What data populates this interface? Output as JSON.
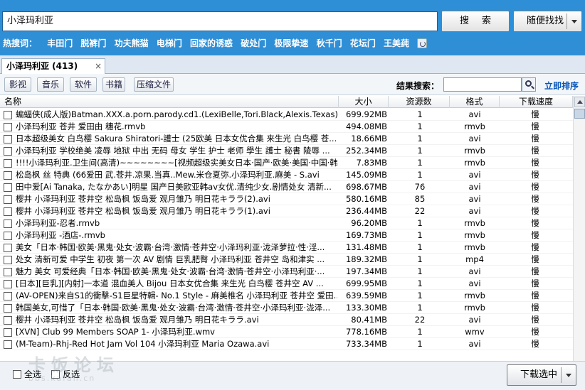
{
  "search": {
    "query": "小泽玛利亚",
    "search_button": "搜索",
    "random_button": "随便找找"
  },
  "hot": {
    "label": "热搜词：",
    "items": [
      "丰田门",
      "脱裤门",
      "功夫熊猫",
      "电梯门",
      "回家的诱惑",
      "破处门",
      "极限挚速",
      "秋千门",
      "花坛门",
      "王美莼"
    ]
  },
  "tab": {
    "label": "小泽玛利亚 (413)",
    "close": "×"
  },
  "filters": {
    "buttons": [
      "影视",
      "音乐",
      "软件",
      "书籍",
      "压缩文件"
    ],
    "result_label": "结果搜索：",
    "sort_link": "立即排序"
  },
  "columns": {
    "name": "名称",
    "size": "大小",
    "resources": "资源数",
    "format": "格式",
    "speed": "下载速度"
  },
  "rows": [
    {
      "name": "蝙蝠侠(成人版)Batman.XXX.a.porn.parody.cd1.(LexiBelle,Tori.Black,Alexis.Texas).Bijou 日...",
      "size": "699.92MB",
      "res": "1",
      "fmt": "avi",
      "speed": "慢"
    },
    {
      "name": "小泽玛利亚 苍井 爱田由 穗花.rmvb",
      "size": "494.08MB",
      "res": "1",
      "fmt": "rmvb",
      "speed": "慢"
    },
    {
      "name": "日本超级美女 白鸟樱 Sakura Shiratori-護士 (25欧美 日本女优合集 来生光 白鸟樱 苍...",
      "size": "18.66MB",
      "res": "1",
      "fmt": "avi",
      "speed": "慢"
    },
    {
      "name": "小泽玛利亚 学校绝美 凌辱 地狱 中出 无码 母女 学生 护士 老师 學生 護士 秘書 陵辱 ...",
      "size": "252.34MB",
      "res": "1",
      "fmt": "rmvb",
      "speed": "慢"
    },
    {
      "name": "!!!!小泽玛利亚.卫生间(高清)~~~~~~~~[视频超级实美女日本·国产·欧美·美国·中国·韩...",
      "size": "7.83MB",
      "res": "1",
      "fmt": "rmvb",
      "speed": "慢"
    },
    {
      "name": "松岛枫 丝 特典 (66爱田 武.苍井.凉果.当真..Mew.米仓夏弥.小泽玛利亚.麻美 - S.avi",
      "size": "145.09MB",
      "res": "1",
      "fmt": "avi",
      "speed": "慢"
    },
    {
      "name": "田中爱[Ai Tanaka, たなかあい]明星 国产日美欧亚韩av女优.清纯少女.剧情处女 清新...",
      "size": "698.67MB",
      "res": "76",
      "fmt": "avi",
      "speed": "慢"
    },
    {
      "name": "樱井 小泽玛利亚 苍井空 松岛枫 饭岛爱 观月雏乃 明日花キララ(2).avi",
      "size": "580.16MB",
      "res": "85",
      "fmt": "avi",
      "speed": "慢"
    },
    {
      "name": "樱井 小泽玛利亚 苍井空 松岛枫 饭岛爱 观月雏乃 明日花キララ(1).avi",
      "size": "236.44MB",
      "res": "22",
      "fmt": "avi",
      "speed": "慢"
    },
    {
      "name": "小泽玛利亚-忍者.rmvb",
      "size": "96.20MB",
      "res": "1",
      "fmt": "rmvb",
      "speed": "慢"
    },
    {
      "name": "小泽玛利亚 -酒店-.rmvb",
      "size": "169.73MB",
      "res": "1",
      "fmt": "rmvb",
      "speed": "慢"
    },
    {
      "name": "美女「日本·韩国·欧美·黑鬼·处女·波霸·台湾·激情·苍井空·小泽玛利亚·泷泽萝拉·性·淫...",
      "size": "131.48MB",
      "res": "1",
      "fmt": "rmvb",
      "speed": "慢"
    },
    {
      "name": "处女 清新可爱 中学生 初夜 第一次 AV 剧情 巨乳肥臀 小泽玛利亚 苍井空 岛和津实 ...",
      "size": "189.32MB",
      "res": "1",
      "fmt": "mp4",
      "speed": "慢"
    },
    {
      "name": "魅力 美女 可爱经典「日本·韩国·欧美·黑鬼·处女·波霸·台湾·激情·苍井空·小泽玛利亚·...",
      "size": "197.34MB",
      "res": "1",
      "fmt": "avi",
      "speed": "慢"
    },
    {
      "name": "[日本][巨乳][内射]一本道 混血美人 Bijou 日本女优合集 来生光 白鸟樱 苍井空 AV ...",
      "size": "699.95MB",
      "res": "1",
      "fmt": "avi",
      "speed": "慢"
    },
    {
      "name": "(AV-OPEN)来自S1的衝擊-S1巨星特輯- No.1 Style - 麻美椎名 小泽玛利亚 苍井空 爱田...",
      "size": "639.59MB",
      "res": "1",
      "fmt": "rmvb",
      "speed": "慢"
    },
    {
      "name": "韩国美女,可惜了「日本·韩国·欧美·黑鬼·处女·波霸·台湾·激情·苍井空·小泽玛利亚·泷泽...",
      "size": "133.30MB",
      "res": "1",
      "fmt": "rmvb",
      "speed": "慢"
    },
    {
      "name": "樱井 小泽玛利亚 苍井空 松岛枫 饭岛爱 观月雏乃 明日花キララ.avi",
      "size": "80.41MB",
      "res": "22",
      "fmt": "avi",
      "speed": "慢"
    },
    {
      "name": "[XVN] Club 99 Members SOAP 1- 小泽玛利亚.wmv",
      "size": "778.16MB",
      "res": "1",
      "fmt": "wmv",
      "speed": "慢"
    },
    {
      "name": "(M-Team)-Rhj-Red Hot Jam Vol 104 小泽玛利亚 Maria Ozawa.avi",
      "size": "733.34MB",
      "res": "1",
      "fmt": "avi",
      "speed": "慢"
    }
  ],
  "footer": {
    "select_all": "全选",
    "invert": "反选",
    "download_button": "下载选中"
  },
  "watermark": {
    "main": "卡饭论坛",
    "sub": "bbs.kafan.cn"
  }
}
